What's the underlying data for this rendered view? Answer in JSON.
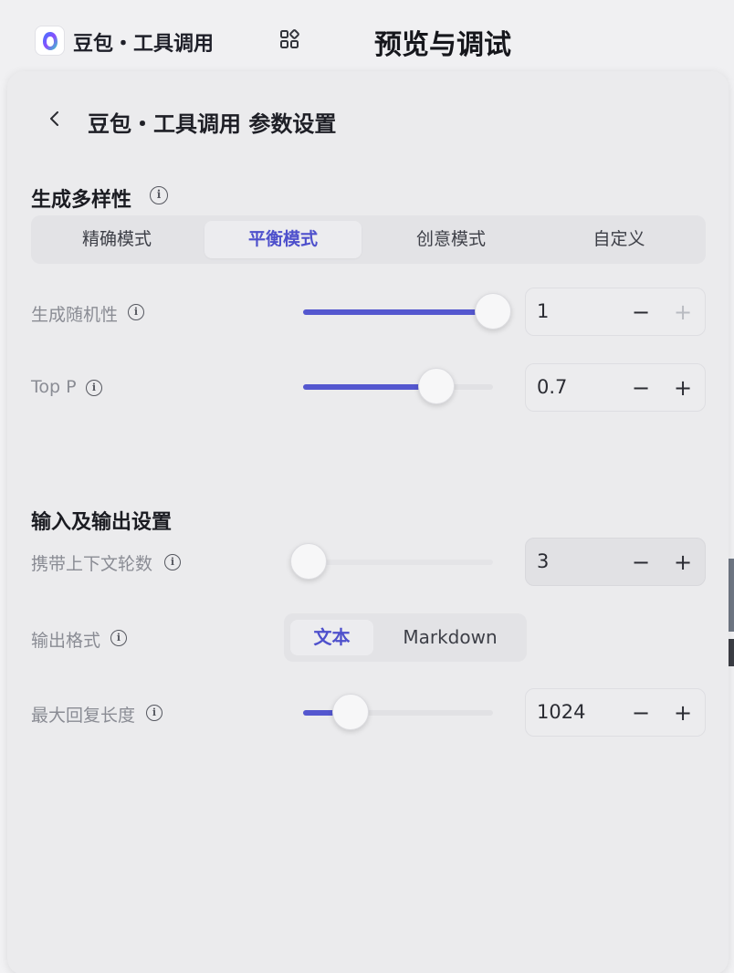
{
  "header": {
    "app_name": "豆包・工具调用",
    "preview_title": "预览与调试"
  },
  "panel": {
    "title": "豆包・工具调用 参数设置"
  },
  "diversity": {
    "title": "生成多样性",
    "modes": [
      {
        "label": "精确模式",
        "active": false
      },
      {
        "label": "平衡模式",
        "active": true
      },
      {
        "label": "创意模式",
        "active": false
      },
      {
        "label": "自定义",
        "active": false
      }
    ],
    "temperature": {
      "label": "生成随机性",
      "value": "1",
      "fraction": 1.0
    },
    "top_p": {
      "label": "Top P",
      "value": "0.7",
      "fraction": 0.7
    }
  },
  "io": {
    "title": "输入及输出设置",
    "context_rounds": {
      "label": "携带上下文轮数",
      "value": "3",
      "fraction": 0.03
    },
    "output_format": {
      "label": "输出格式",
      "options": [
        "文本",
        "Markdown"
      ],
      "selected": "文本"
    },
    "max_length": {
      "label": "最大回复长度",
      "value": "1024",
      "fraction": 0.25
    }
  },
  "icons": {
    "back": "chevron-left-icon",
    "grid": "grid-icon",
    "info": "info-icon",
    "logo": "doubao-logo"
  },
  "colors": {
    "accent": "#5457cf",
    "accent_text": "#4e50cc"
  }
}
